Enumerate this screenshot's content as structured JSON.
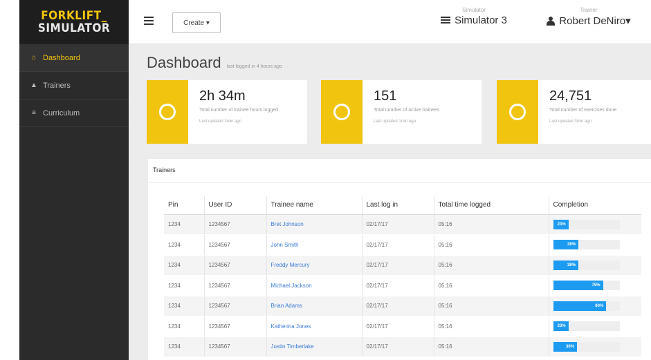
{
  "logo": {
    "line1": "FORKLIFT_",
    "line2": "SIMULATOR"
  },
  "sidebar": {
    "items": [
      {
        "label": "Dashboard",
        "icon": "home-icon",
        "active": true
      },
      {
        "label": "Trainers",
        "icon": "user-icon",
        "active": false
      },
      {
        "label": "Curriculum",
        "icon": "list-icon",
        "active": false
      }
    ]
  },
  "topbar": {
    "create_label": "Create ▾",
    "simulator_small": "Simulator",
    "simulator_value": "Simulator 3",
    "trainer_small": "Trainer",
    "trainer_value": "Robert DeNiro▾"
  },
  "page": {
    "title": "Dashboard",
    "subtitle": "last logged in 4 hours ago"
  },
  "cards": [
    {
      "value": "2h 34m",
      "desc": "Total number of trainee hours logged",
      "updated": "Last updated 3min ago",
      "icon": "clock-icon"
    },
    {
      "value": "151",
      "desc": "Total number of active trainees",
      "updated": "Last updated 1min ago",
      "icon": "user-circle-icon"
    },
    {
      "value": "24,751",
      "desc": "Total number of exercises done",
      "updated": "Last updated 3min ago",
      "icon": "note-icon"
    }
  ],
  "trainers": {
    "panel_title": "Trainers",
    "headers": [
      "Pin",
      "User ID",
      "Trainee name",
      "Last log in",
      "Total time logged",
      "Completion"
    ],
    "rows": [
      {
        "pin": "1234",
        "user_id": "1234567",
        "name": "Bret Johnson",
        "last_login": "02/17/17",
        "total_time": "05:16",
        "completion_pct": 23,
        "completion_label": "23%"
      },
      {
        "pin": "1234",
        "user_id": "1234567",
        "name": "John Smith",
        "last_login": "02/17/17",
        "total_time": "05:16",
        "completion_pct": 38,
        "completion_label": "38%"
      },
      {
        "pin": "1234",
        "user_id": "1234567",
        "name": "Freddy Mercury",
        "last_login": "02/17/17",
        "total_time": "05:16",
        "completion_pct": 38,
        "completion_label": "38%"
      },
      {
        "pin": "1234",
        "user_id": "1234567",
        "name": "Michael Jackson",
        "last_login": "02/17/17",
        "total_time": "05:16",
        "completion_pct": 75,
        "completion_label": "75%"
      },
      {
        "pin": "1234",
        "user_id": "1234567",
        "name": "Brian Adams",
        "last_login": "02/17/17",
        "total_time": "05:16",
        "completion_pct": 80,
        "completion_label": "80%"
      },
      {
        "pin": "1234",
        "user_id": "1234567",
        "name": "Katherina Jones",
        "last_login": "02/17/17",
        "total_time": "05:16",
        "completion_pct": 23,
        "completion_label": "23%"
      },
      {
        "pin": "1234",
        "user_id": "1234567",
        "name": "Justin Timberlake",
        "last_login": "02/17/17",
        "total_time": "05:16",
        "completion_pct": 36,
        "completion_label": "36%"
      }
    ]
  },
  "colors": {
    "accent": "#f1c40f",
    "progress": "#1d9bf0",
    "link": "#3a7bd5",
    "sidebar": "#2b2b2b"
  }
}
